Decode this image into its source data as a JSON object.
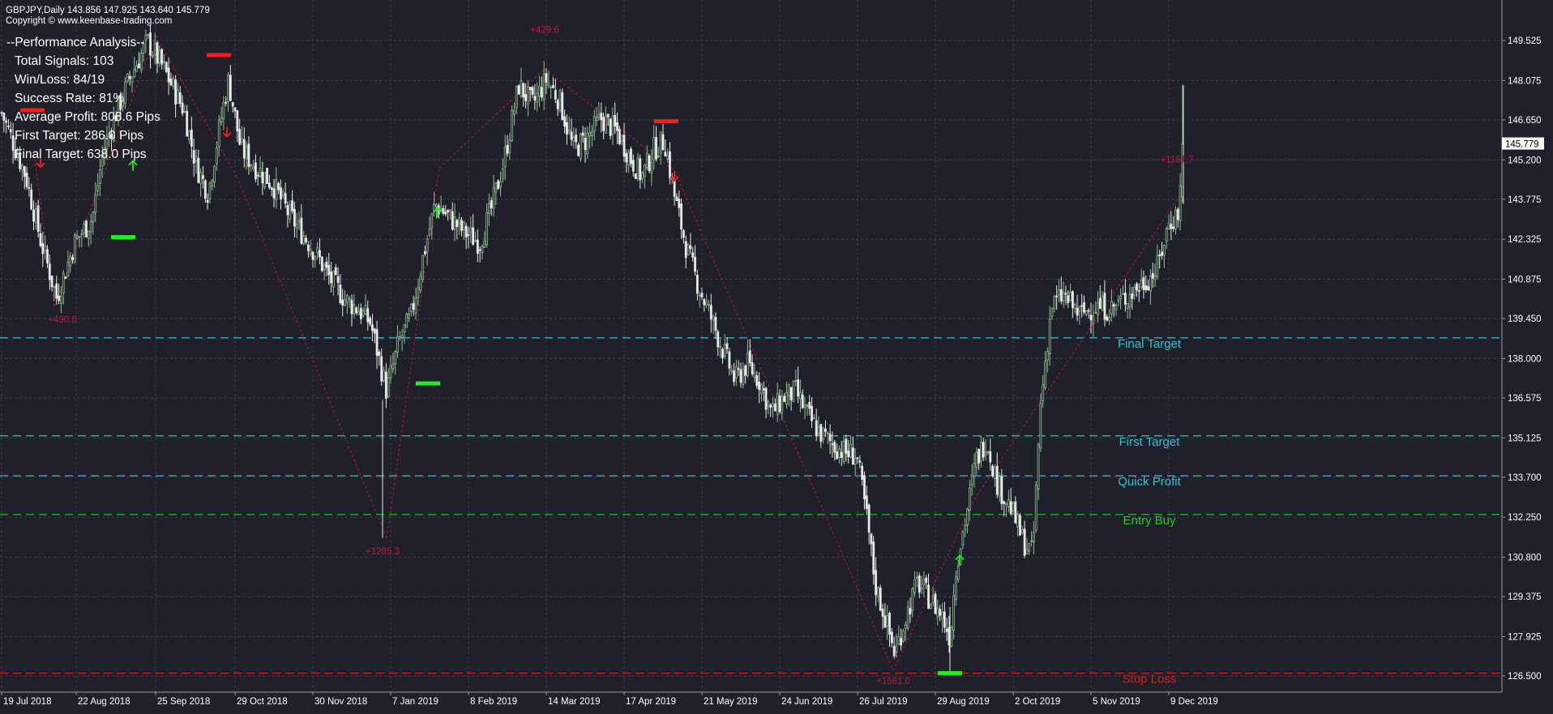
{
  "header": {
    "symbol_line": "GBPJPY,Daily  143.856 147.925 143.640 145.779",
    "copyright": "Copyright © www.keenbase-trading.com"
  },
  "performance": {
    "title": "--Performance Analysis--",
    "lines": [
      "Total Signals: 103",
      "Win/Loss: 84/19",
      "Success Rate: 81%",
      "Average Profit: 808.6 Pips",
      "First Target: 286.0 Pips",
      "Final Target: 638.0 Pips"
    ]
  },
  "colors": {
    "background": "#1f2029",
    "grid": "#3a3c4a",
    "bull_candle": "#8fbf8f",
    "bear_candle": "#e8e8e8",
    "target_line": "#2ec4d4",
    "entry_line": "#1fd41f",
    "stop_line": "#e01a1a",
    "zigzag": "#c8143c",
    "sell_marker": "#ff1a1a",
    "buy_marker": "#22ee22"
  },
  "chart_data": {
    "type": "candlestick",
    "symbol": "GBPJPY",
    "timeframe": "Daily",
    "ohlc_last": {
      "open": 143.856,
      "high": 147.925,
      "low": 143.64,
      "close": 145.779
    },
    "current_price_label": "145.779",
    "ylim": [
      126.0,
      150.2
    ],
    "y_ticks": [
      "149.525",
      "148.075",
      "146.650",
      "145.200",
      "143.775",
      "142.325",
      "140.875",
      "139.450",
      "138.000",
      "136.575",
      "135.125",
      "133.700",
      "132.250",
      "130.800",
      "129.375",
      "127.925",
      "126.500"
    ],
    "x_ticks": [
      "19 Jul 2018",
      "22 Aug 2018",
      "25 Sep 2018",
      "29 Oct 2018",
      "30 Nov 2018",
      "7 Jan 2019",
      "8 Feb 2019",
      "14 Mar 2019",
      "17 Apr 2019",
      "21 May 2019",
      "24 Jun 2019",
      "26 Jul 2019",
      "29 Aug 2019",
      "2 Oct 2019",
      "5 Nov 2019",
      "9 Dec 2019"
    ],
    "price_path": [
      {
        "t": 0,
        "p": 146.9
      },
      {
        "t": 12,
        "p": 146.0
      },
      {
        "t": 30,
        "p": 144.6
      },
      {
        "t": 48,
        "p": 142.3
      },
      {
        "t": 68,
        "p": 140.2
      },
      {
        "t": 90,
        "p": 142.2
      },
      {
        "t": 112,
        "p": 143.1
      },
      {
        "t": 125,
        "p": 145.5
      },
      {
        "t": 140,
        "p": 146.8
      },
      {
        "t": 160,
        "p": 148.3
      },
      {
        "t": 180,
        "p": 149.5
      },
      {
        "t": 200,
        "p": 148.5
      },
      {
        "t": 225,
        "p": 147.0
      },
      {
        "t": 240,
        "p": 145.0
      },
      {
        "t": 255,
        "p": 144.0
      },
      {
        "t": 270,
        "p": 146.6
      },
      {
        "t": 280,
        "p": 148.1
      },
      {
        "t": 295,
        "p": 145.6
      },
      {
        "t": 315,
        "p": 144.9
      },
      {
        "t": 335,
        "p": 144.3
      },
      {
        "t": 355,
        "p": 143.2
      },
      {
        "t": 372,
        "p": 142.5
      },
      {
        "t": 388,
        "p": 141.8
      },
      {
        "t": 405,
        "p": 140.9
      },
      {
        "t": 425,
        "p": 140.1
      },
      {
        "t": 440,
        "p": 139.8
      },
      {
        "t": 455,
        "p": 139.3
      },
      {
        "t": 468,
        "p": 137.7
      },
      {
        "t": 475,
        "p": 136.8
      },
      {
        "t": 490,
        "p": 138.6
      },
      {
        "t": 505,
        "p": 139.5
      },
      {
        "t": 520,
        "p": 141.7
      },
      {
        "t": 535,
        "p": 143.6
      },
      {
        "t": 550,
        "p": 143.2
      },
      {
        "t": 570,
        "p": 142.6
      },
      {
        "t": 590,
        "p": 142.2
      },
      {
        "t": 605,
        "p": 143.5
      },
      {
        "t": 620,
        "p": 145.2
      },
      {
        "t": 638,
        "p": 147.9
      },
      {
        "t": 655,
        "p": 147.2
      },
      {
        "t": 672,
        "p": 148.1
      },
      {
        "t": 688,
        "p": 147.4
      },
      {
        "t": 705,
        "p": 145.6
      },
      {
        "t": 720,
        "p": 145.9
      },
      {
        "t": 740,
        "p": 146.7
      },
      {
        "t": 760,
        "p": 146.2
      },
      {
        "t": 775,
        "p": 145.3
      },
      {
        "t": 790,
        "p": 144.6
      },
      {
        "t": 805,
        "p": 145.6
      },
      {
        "t": 818,
        "p": 145.9
      },
      {
        "t": 830,
        "p": 143.9
      },
      {
        "t": 845,
        "p": 142.0
      },
      {
        "t": 860,
        "p": 140.6
      },
      {
        "t": 875,
        "p": 139.5
      },
      {
        "t": 890,
        "p": 138.3
      },
      {
        "t": 905,
        "p": 137.2
      },
      {
        "t": 920,
        "p": 137.8
      },
      {
        "t": 935,
        "p": 137.2
      },
      {
        "t": 950,
        "p": 136.0
      },
      {
        "t": 965,
        "p": 136.6
      },
      {
        "t": 980,
        "p": 136.8
      },
      {
        "t": 995,
        "p": 135.9
      },
      {
        "t": 1010,
        "p": 135.3
      },
      {
        "t": 1025,
        "p": 134.9
      },
      {
        "t": 1040,
        "p": 134.6
      },
      {
        "t": 1055,
        "p": 134.5
      },
      {
        "t": 1068,
        "p": 132.1
      },
      {
        "t": 1078,
        "p": 129.8
      },
      {
        "t": 1090,
        "p": 128.6
      },
      {
        "t": 1102,
        "p": 127.3
      },
      {
        "t": 1115,
        "p": 128.6
      },
      {
        "t": 1130,
        "p": 129.9
      },
      {
        "t": 1145,
        "p": 129.3
      },
      {
        "t": 1160,
        "p": 128.7
      },
      {
        "t": 1170,
        "p": 127.9
      },
      {
        "t": 1178,
        "p": 130.6
      },
      {
        "t": 1190,
        "p": 132.3
      },
      {
        "t": 1202,
        "p": 134.3
      },
      {
        "t": 1215,
        "p": 135.1
      },
      {
        "t": 1228,
        "p": 133.5
      },
      {
        "t": 1245,
        "p": 132.6
      },
      {
        "t": 1260,
        "p": 131.4
      },
      {
        "t": 1272,
        "p": 130.9
      },
      {
        "t": 1282,
        "p": 136.4
      },
      {
        "t": 1295,
        "p": 139.9
      },
      {
        "t": 1310,
        "p": 140.3
      },
      {
        "t": 1330,
        "p": 139.6
      },
      {
        "t": 1350,
        "p": 139.9
      },
      {
        "t": 1370,
        "p": 139.8
      },
      {
        "t": 1390,
        "p": 140.3
      },
      {
        "t": 1410,
        "p": 140.8
      },
      {
        "t": 1425,
        "p": 141.2
      },
      {
        "t": 1440,
        "p": 142.9
      },
      {
        "t": 1452,
        "p": 143.3
      },
      {
        "t": 1458,
        "p": 145.8
      }
    ],
    "levels": [
      {
        "label": "Final Target",
        "price": 138.75,
        "kind": "target"
      },
      {
        "label": "First Target",
        "price": 135.2,
        "kind": "target"
      },
      {
        "label": "Quick Profit",
        "price": 133.75,
        "kind": "target"
      },
      {
        "label": "Entry Buy",
        "price": 132.35,
        "kind": "entry"
      },
      {
        "label": "Stop Loss",
        "price": 126.6,
        "kind": "stop"
      }
    ],
    "zigzag": [
      {
        "t": 40,
        "p": 145.4
      },
      {
        "t": 65,
        "p": 139.9
      },
      {
        "t": 190,
        "p": 149.7
      },
      {
        "t": 290,
        "p": 144.6
      },
      {
        "t": 475,
        "p": 131.5
      },
      {
        "t": 540,
        "p": 144.9
      },
      {
        "t": 670,
        "p": 148.5
      },
      {
        "t": 830,
        "p": 144.8
      },
      {
        "t": 1100,
        "p": 126.7
      },
      {
        "t": 1200,
        "p": 132.9
      },
      {
        "t": 1458,
        "p": 144.1
      }
    ],
    "pip_labels": [
      {
        "text": "+430.0",
        "t": 75,
        "p": 139.3
      },
      {
        "text": "+429.6",
        "t": 670,
        "p": 149.8
      },
      {
        "text": "+1285.3",
        "t": 470,
        "p": 130.9
      },
      {
        "text": "+1661.0",
        "t": 1100,
        "p": 126.2
      },
      {
        "text": "+1161.7",
        "t": 1450,
        "p": 145.1
      }
    ],
    "signal_bars": [
      {
        "kind": "sell",
        "t": 38,
        "p": 147.0
      },
      {
        "kind": "sell",
        "t": 268,
        "p": 149.0
      },
      {
        "kind": "sell",
        "t": 820,
        "p": 146.6
      },
      {
        "kind": "buy",
        "t": 150,
        "p": 142.4
      },
      {
        "kind": "buy",
        "t": 526,
        "p": 137.1
      },
      {
        "kind": "buy",
        "t": 1170,
        "p": 126.6
      }
    ],
    "arrows": [
      {
        "kind": "sell",
        "t": 48,
        "p": 145.0
      },
      {
        "kind": "sell",
        "t": 278,
        "p": 146.1
      },
      {
        "kind": "sell",
        "t": 830,
        "p": 144.5
      },
      {
        "kind": "buy",
        "t": 162,
        "p": 145.1
      },
      {
        "kind": "buy",
        "t": 538,
        "p": 143.4
      },
      {
        "kind": "buy",
        "t": 1182,
        "p": 130.8
      }
    ]
  }
}
